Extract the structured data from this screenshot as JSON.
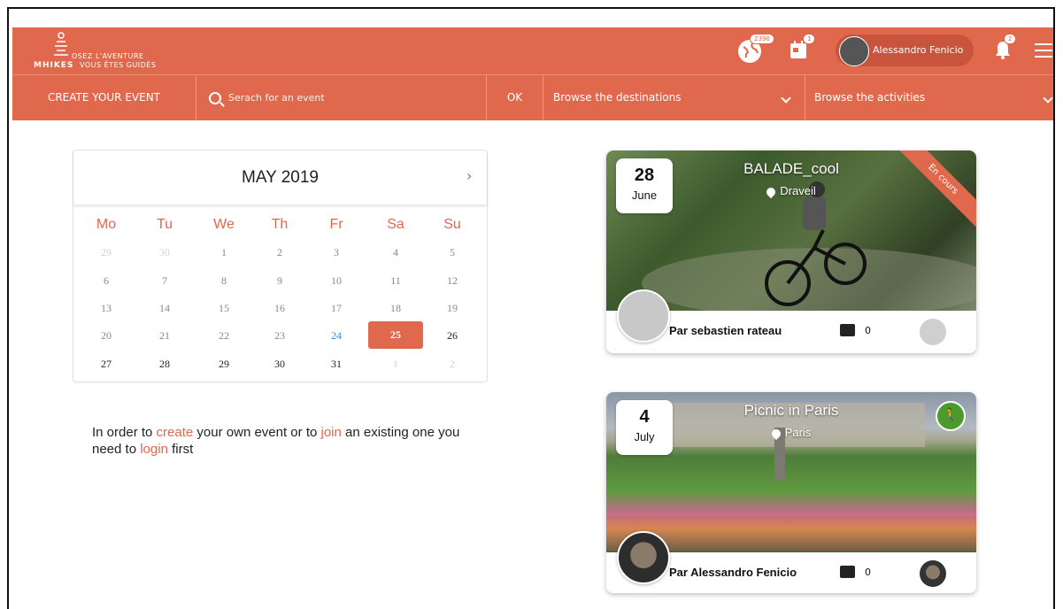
{
  "header": {
    "brand": "MHIKES",
    "tagline_top": "OSEZ L'AVENTURE",
    "tagline_bottom": "VOUS ÊTES GUIDÉS",
    "globe_badge": "2390",
    "calendar_badge": "1",
    "user_name": "Alessandro Fenicio",
    "notification_badge": "2"
  },
  "subnav": {
    "create_label": "CREATE YOUR EVENT",
    "search_placeholder": "Serach for an event",
    "ok_label": "OK",
    "destinations_label": "Browse the destinations",
    "activities_label": "Browse the activities"
  },
  "calendar": {
    "title": "MAY 2019",
    "next": "›",
    "weekdays": [
      "Mo",
      "Tu",
      "We",
      "Th",
      "Fr",
      "Sa",
      "Su"
    ],
    "weeks": [
      [
        "29",
        "30",
        "1",
        "2",
        "3",
        "4",
        "5"
      ],
      [
        "6",
        "7",
        "8",
        "9",
        "10",
        "11",
        "12"
      ],
      [
        "13",
        "14",
        "15",
        "16",
        "17",
        "18",
        "19"
      ],
      [
        "20",
        "21",
        "22",
        "23",
        "24",
        "25",
        "26"
      ],
      [
        "27",
        "28",
        "29",
        "30",
        "31",
        "1",
        "2"
      ]
    ],
    "selected_day": "25",
    "today_day": "24"
  },
  "login_message": {
    "p1": "In order to ",
    "create": "create",
    "p2": " your own event or to ",
    "join": "join",
    "p3": " an existing one you need to ",
    "login": "login",
    "p4": " first"
  },
  "events": [
    {
      "day": "28",
      "month": "June",
      "title": "BALADE_cool",
      "location": "Draveil",
      "status": "En cours",
      "author": "Par sebastien rateau",
      "comments": "0"
    },
    {
      "day": "4",
      "month": "July",
      "title": "Picnic in Paris",
      "location": "Paris",
      "activity_icon": "hiker-icon",
      "author": "Par Alessandro Fenicio",
      "comments": "0"
    }
  ],
  "colors": {
    "brand": "#e0684d",
    "today": "#3b8fd4"
  }
}
